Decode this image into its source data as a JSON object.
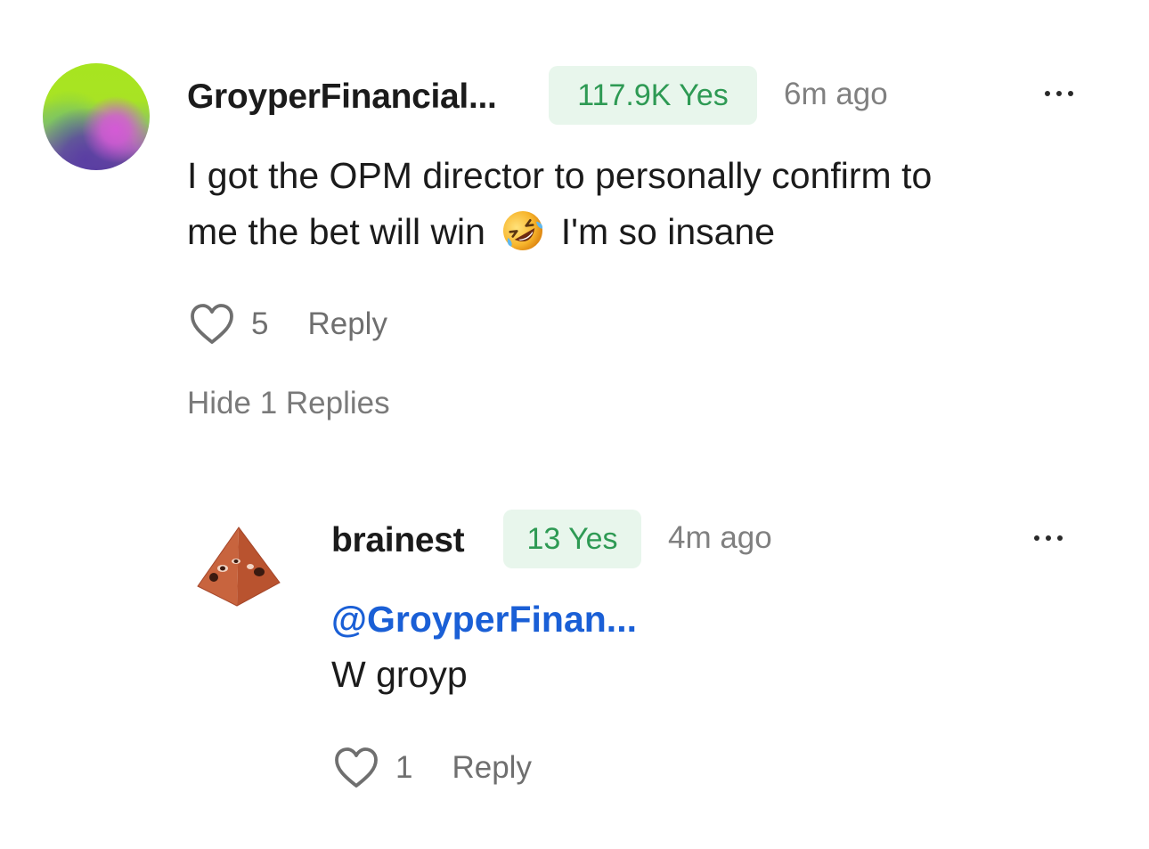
{
  "comment": {
    "username": "GroyperFinancial...",
    "badge": "117.9K Yes",
    "time": "6m ago",
    "text_line1": "I got the OPM director to personally confirm to",
    "text_line2_a": "me the bet will win",
    "text_line2_b": "I'm so insane",
    "emoji": "rolling-on-floor-laughing-emoji",
    "likes": "5",
    "reply_label": "Reply",
    "hide_replies_label": "Hide 1 Replies"
  },
  "reply": {
    "username": "brainest",
    "badge": "13 Yes",
    "time": "4m ago",
    "mention": "@GroyperFinan...",
    "text": "W groyp",
    "likes": "1",
    "reply_label": "Reply"
  },
  "colors": {
    "badge_bg": "#e8f6ec",
    "badge_text": "#2e9a54",
    "mention": "#1a5fd6",
    "muted": "#808080"
  }
}
